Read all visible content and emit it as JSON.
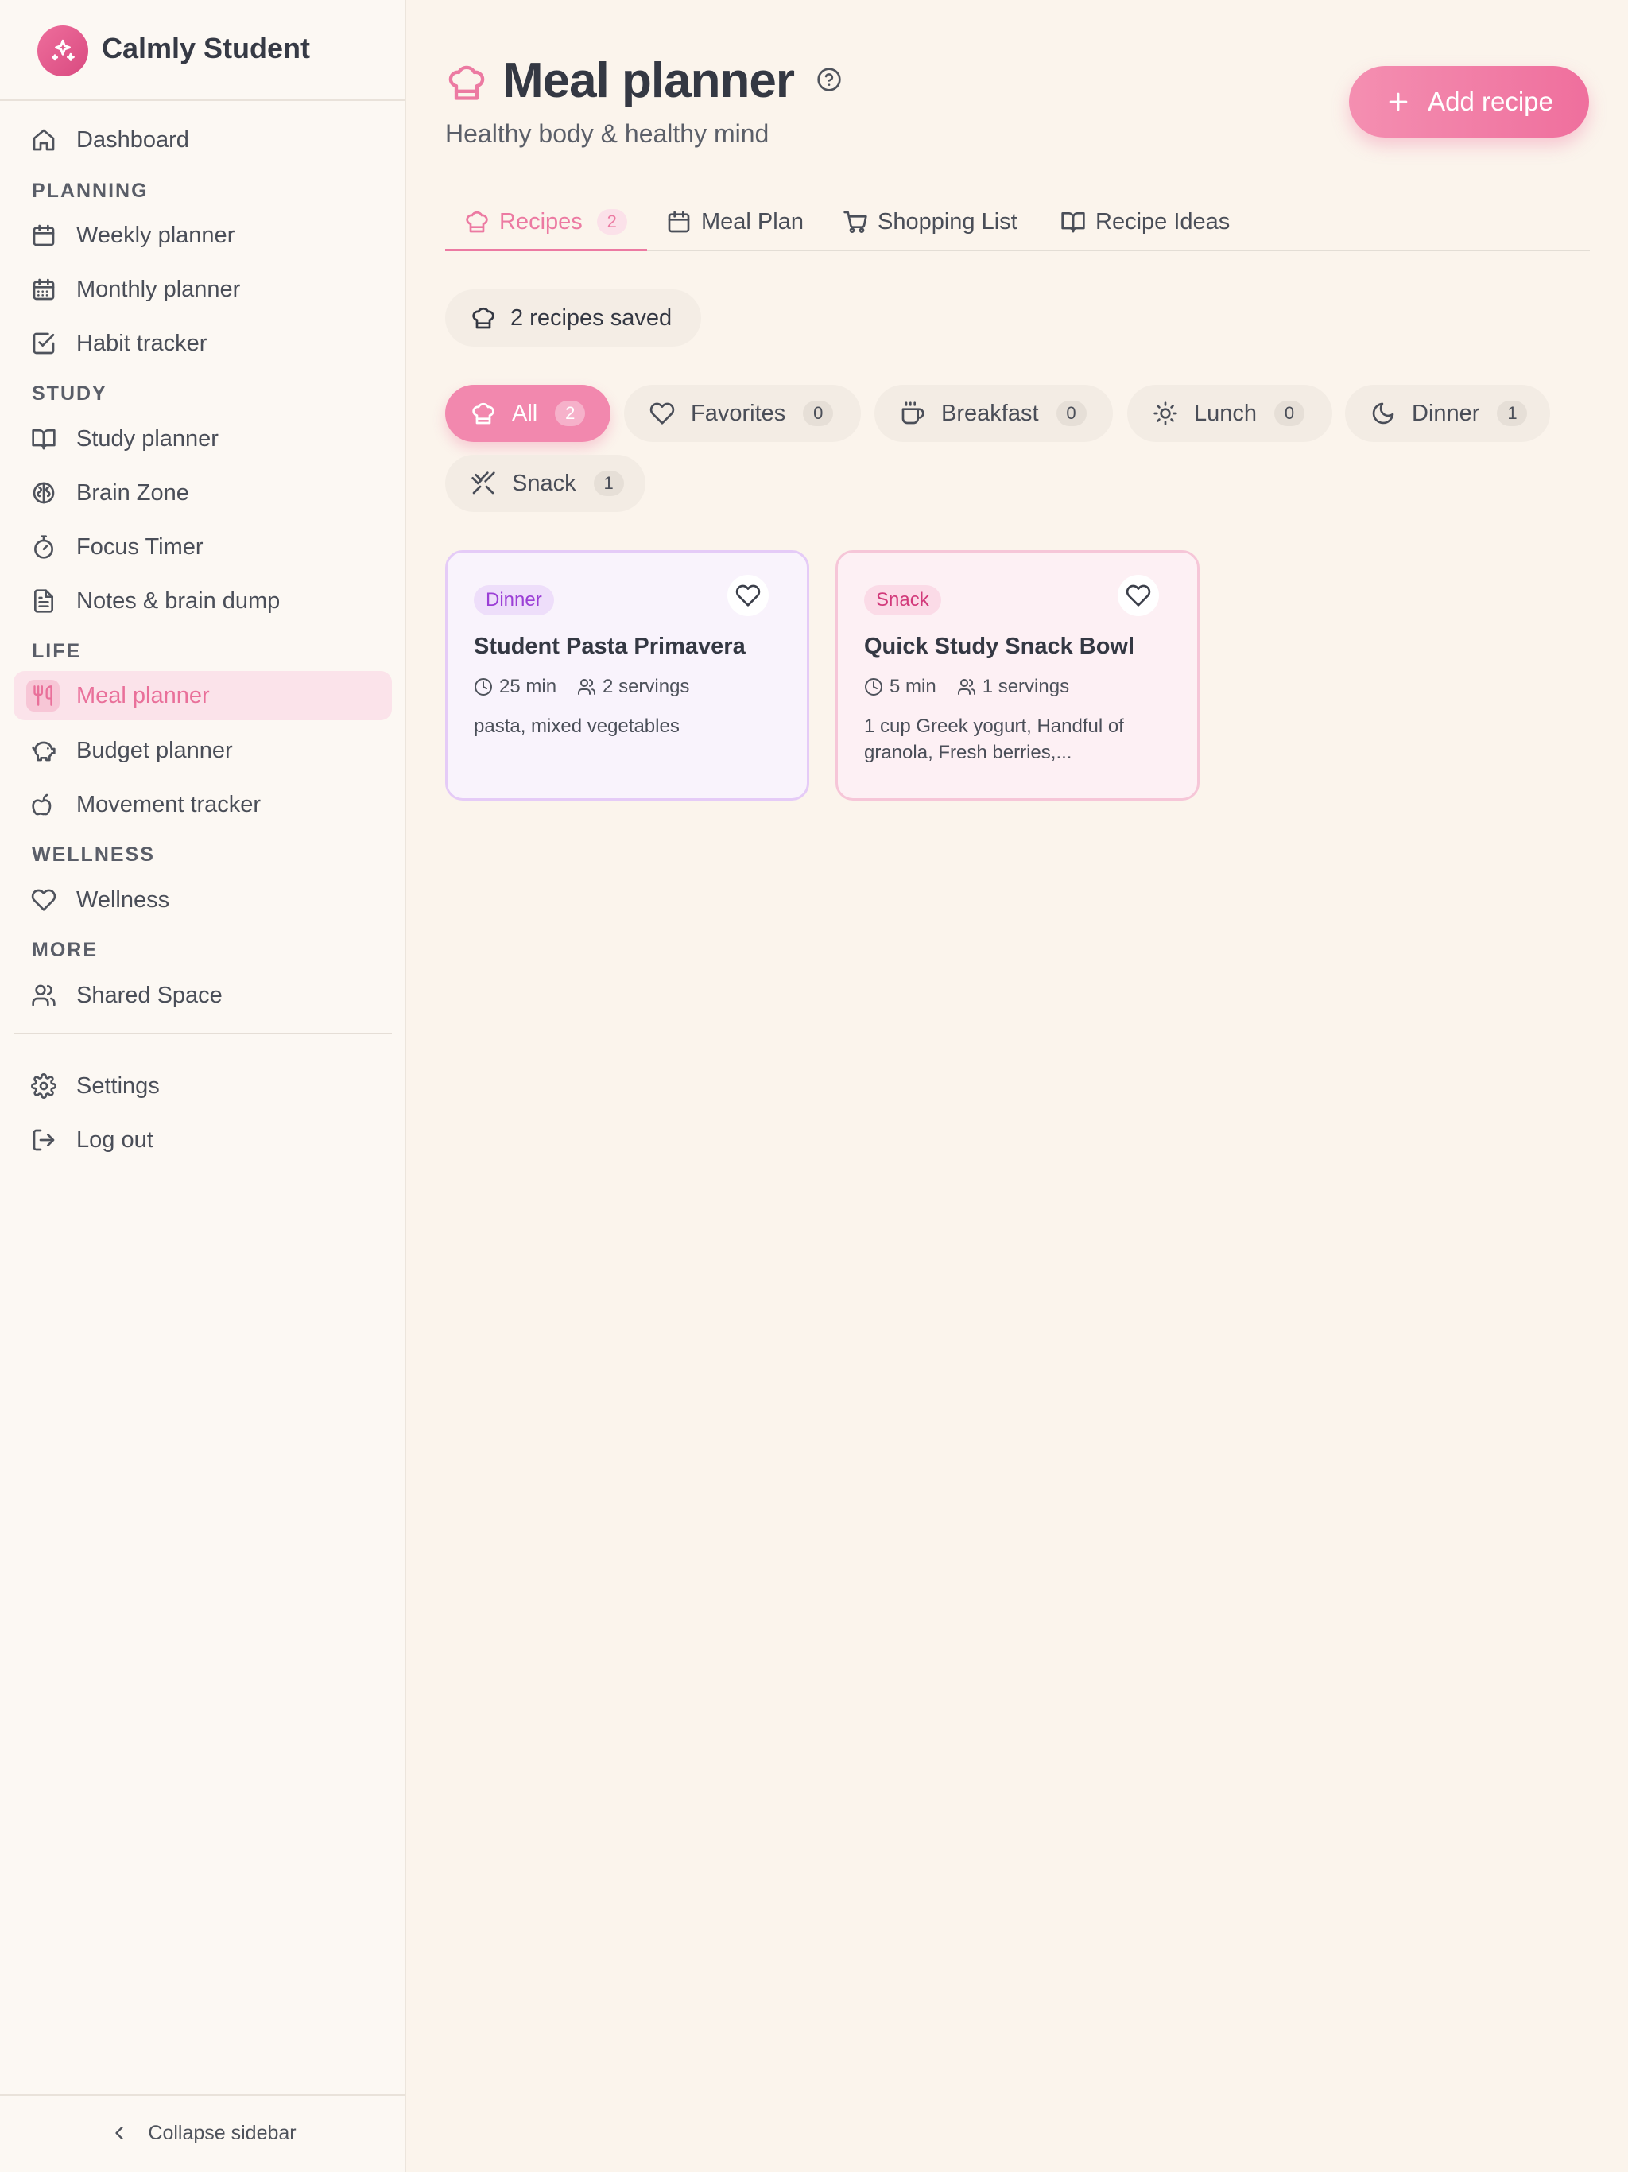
{
  "app": {
    "name": "Calmly Student"
  },
  "sidebar": {
    "items": {
      "dashboard": "Dashboard",
      "weekly": "Weekly planner",
      "monthly": "Monthly planner",
      "habit": "Habit tracker",
      "study": "Study planner",
      "brain": "Brain Zone",
      "focus": "Focus Timer",
      "notes": "Notes & brain dump",
      "meal": "Meal planner",
      "budget": "Budget planner",
      "movement": "Movement tracker",
      "wellness": "Wellness",
      "shared": "Shared Space",
      "settings": "Settings",
      "logout": "Log out"
    },
    "sections": {
      "planning": "PLANNING",
      "study": "STUDY",
      "life": "LIFE",
      "wellness": "WELLNESS",
      "more": "MORE"
    },
    "active_item": "Meal planner",
    "collapse_label": "Collapse sidebar"
  },
  "header": {
    "title": "Meal planner",
    "subtitle": "Healthy body & healthy mind",
    "add_button": "Add recipe"
  },
  "tabs": {
    "recipes": {
      "label": "Recipes",
      "count": "2"
    },
    "meal_plan": {
      "label": "Meal Plan"
    },
    "shopping": {
      "label": "Shopping List"
    },
    "ideas": {
      "label": "Recipe Ideas"
    }
  },
  "summary": {
    "saved": "2 recipes saved"
  },
  "filters": {
    "all": {
      "label": "All",
      "count": "2"
    },
    "favorites": {
      "label": "Favorites",
      "count": "0"
    },
    "breakfast": {
      "label": "Breakfast",
      "count": "0"
    },
    "lunch": {
      "label": "Lunch",
      "count": "0"
    },
    "dinner": {
      "label": "Dinner",
      "count": "1"
    },
    "snack": {
      "label": "Snack",
      "count": "1"
    }
  },
  "recipes": [
    {
      "category": "Dinner",
      "title": "Student Pasta Primavera",
      "time": "25 min",
      "servings": "2 servings",
      "ingredients": "pasta, mixed vegetables"
    },
    {
      "category": "Snack",
      "title": "Quick Study Snack Bowl",
      "time": "5 min",
      "servings": "1 servings",
      "ingredients": "1 cup Greek yogurt, Handful of granola, Fresh berries,..."
    }
  ],
  "colors": {
    "accent": "#ec7aa2",
    "background": "#fbf4ec",
    "sidebar": "#fcf8f3",
    "dinner_badge": "#9b3fd6",
    "snack_badge": "#d2397a"
  }
}
